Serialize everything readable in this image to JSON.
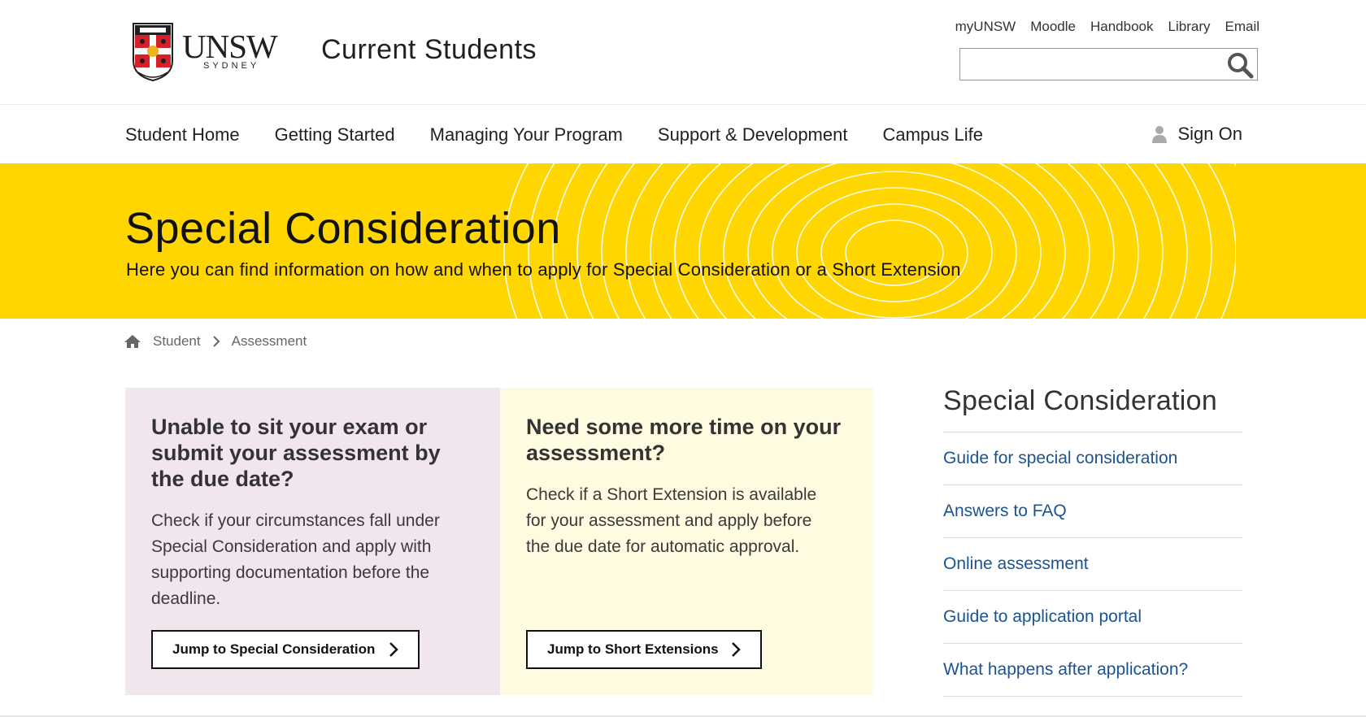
{
  "header": {
    "logo_text": "UNSW",
    "logo_sub": "SYDNEY",
    "site_title": "Current Students",
    "top_links": [
      "myUNSW",
      "Moodle",
      "Handbook",
      "Library",
      "Email"
    ],
    "search_placeholder": ""
  },
  "nav": {
    "items": [
      "Student Home",
      "Getting Started",
      "Managing Your Program",
      "Support & Development",
      "Campus Life"
    ],
    "signon_label": "Sign On"
  },
  "hero": {
    "title": "Special Consideration",
    "subtitle": "Here you can find information on how and when to apply for Special Consideration or a Short Extension",
    "background_color": "#ffd600"
  },
  "breadcrumb": {
    "items": [
      "Student",
      "Assessment"
    ]
  },
  "cards": {
    "left": {
      "heading": "Unable to sit your exam or submit your assessment by the due date?",
      "body": "Check if your circumstances fall under Special Consideration and apply with supporting documentation before the deadline.",
      "button_label": "Jump to Special Consideration",
      "background_color": "#f1e5ee"
    },
    "right": {
      "heading": "Need some more time on your assessment?",
      "body": "Check if a Short Extension is available for your assessment and apply before the due date for automatic approval.",
      "button_label": "Jump to Short Extensions",
      "background_color": "#fffbe0"
    }
  },
  "sidebar": {
    "title": "Special Consideration",
    "links": [
      "Guide for special consideration",
      "Answers to FAQ",
      "Online assessment",
      "Guide to application portal",
      "What happens after application?"
    ],
    "link_color": "#1a5490"
  }
}
